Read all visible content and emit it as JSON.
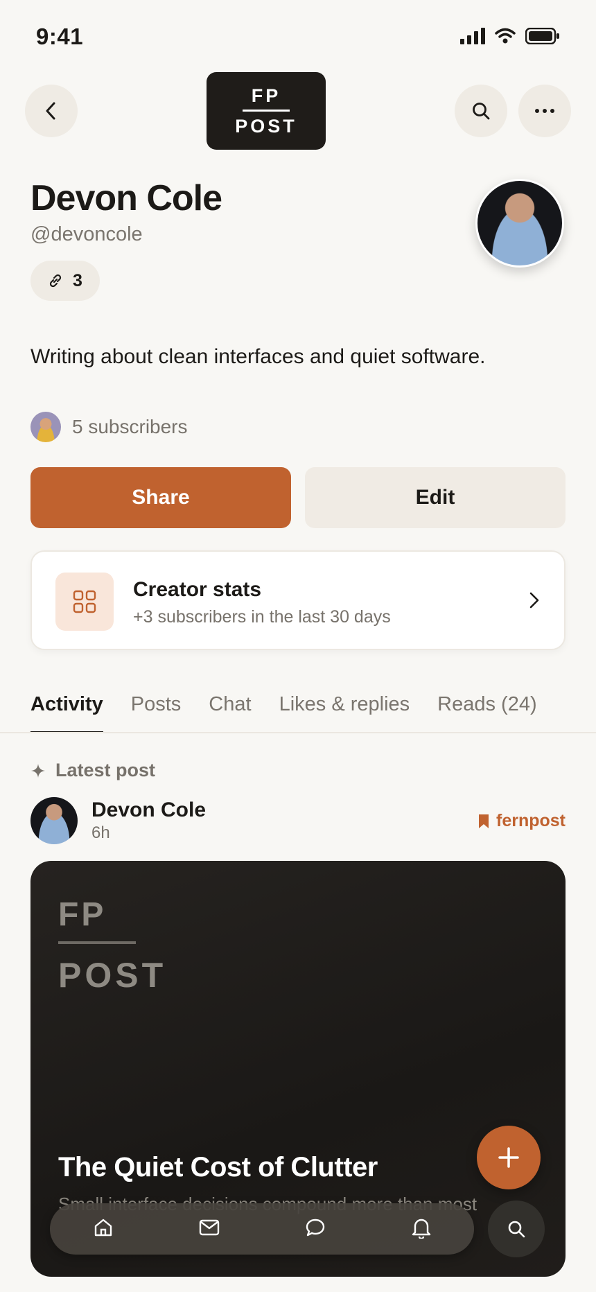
{
  "status_bar": {
    "time": "9:41"
  },
  "header": {
    "logo_top": "FP",
    "logo_bottom": "POST"
  },
  "profile": {
    "name": "Devon Cole",
    "handle": "@devoncole",
    "links_count": "3",
    "bio": "Writing about clean interfaces and quiet software.",
    "subscribers": "5 subscribers"
  },
  "actions": {
    "share_label": "Share",
    "edit_label": "Edit"
  },
  "stats_card": {
    "title": "Creator stats",
    "subtitle": "+3 subscribers in the last 30 days"
  },
  "tabs": [
    {
      "label": "Activity",
      "active": true
    },
    {
      "label": "Posts"
    },
    {
      "label": "Chat"
    },
    {
      "label": "Likes & replies"
    },
    {
      "label": "Reads (24)"
    }
  ],
  "feed": {
    "section_label": "Latest post",
    "post": {
      "author": "Devon Cole",
      "time": "6h",
      "publication": "fernpost",
      "cover_top": "FP",
      "cover_bottom": "POST",
      "title": "The Quiet Cost of Clutter",
      "subtitle": "Small interface decisions compound more than most"
    }
  },
  "colors": {
    "accent": "#c0622f",
    "background": "#f8f7f4",
    "text": "#1c1a17",
    "muted": "#77726b"
  },
  "icons": {
    "back": "chevron-left-icon",
    "search": "search-icon",
    "more": "more-horizontal-icon",
    "link": "link-icon",
    "stats": "grid-icon",
    "chevron": "chevron-right-icon",
    "sparkle": "sparkle-icon",
    "bookmark": "bookmark-icon",
    "plus": "plus-icon",
    "home": "home-icon",
    "mail": "mail-icon",
    "chat": "chat-bubble-icon",
    "bell": "bell-icon"
  }
}
